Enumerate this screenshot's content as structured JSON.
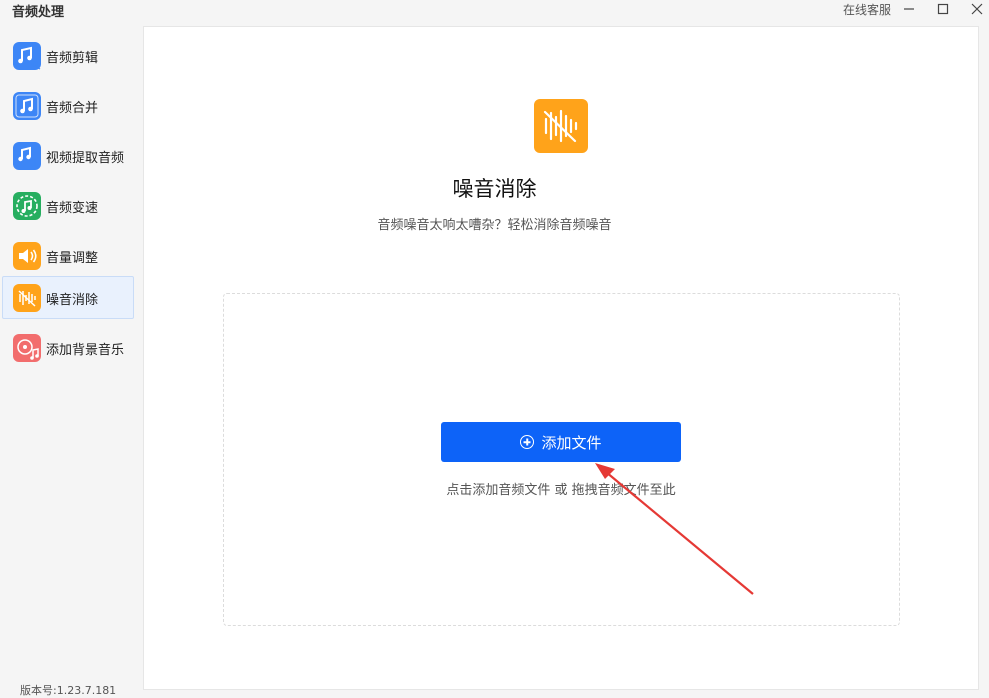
{
  "titlebar": {
    "title": "音频处理",
    "support": "在线客服",
    "minimize_icon": "minimize-icon",
    "maximize_icon": "maximize-icon",
    "close_icon": "close-icon"
  },
  "sidebar": {
    "items": [
      {
        "label": "音频剪辑",
        "icon": "audio-cut-icon",
        "color": "#3d86f6"
      },
      {
        "label": "音频合并",
        "icon": "audio-merge-icon",
        "color": "#3d86f6"
      },
      {
        "label": "视频提取音频",
        "icon": "video-extract-audio-icon",
        "color": "#3d86f6"
      },
      {
        "label": "音频变速",
        "icon": "audio-speed-icon",
        "color": "#27ae60"
      },
      {
        "label": "音量调整",
        "icon": "volume-icon",
        "color": "#ffa31a"
      },
      {
        "label": "噪音消除",
        "icon": "noise-remove-icon",
        "color": "#ffa31a",
        "active": true
      },
      {
        "label": "添加背景音乐",
        "icon": "background-music-icon",
        "color": "#f26d6d"
      }
    ],
    "version": "版本号:1.23.7.181"
  },
  "main": {
    "icon": "noise-remove-icon",
    "title": "噪音消除",
    "subtitle": "音频噪音太响太嘈杂？轻松消除音频噪音",
    "add_button": "添加文件",
    "hint": "点击添加音频文件 或 拖拽音频文件至此"
  },
  "colors": {
    "accent": "#0d63f8",
    "active_bg": "#e9f1fd",
    "orange": "#ffa31a",
    "annotation_arrow": "#e53935"
  }
}
